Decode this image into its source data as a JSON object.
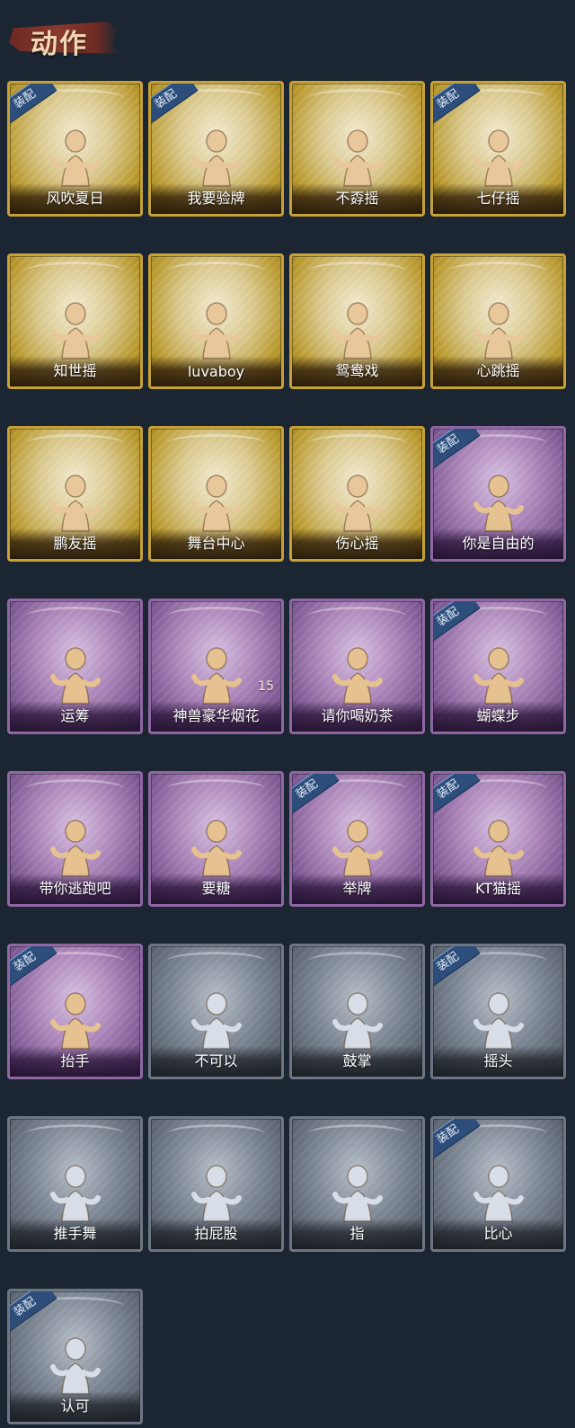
{
  "title": "动作",
  "badge_label": "装配",
  "cards": [
    {
      "label": "风吹夏日",
      "tier": "gold",
      "equipped": true,
      "count": ""
    },
    {
      "label": "我要验牌",
      "tier": "gold",
      "equipped": true,
      "count": ""
    },
    {
      "label": "不孬摇",
      "tier": "gold",
      "equipped": false,
      "count": ""
    },
    {
      "label": "七仔摇",
      "tier": "gold",
      "equipped": true,
      "count": ""
    },
    {
      "label": "知世摇",
      "tier": "gold",
      "equipped": false,
      "count": ""
    },
    {
      "label": "luvaboy",
      "tier": "gold",
      "equipped": false,
      "count": ""
    },
    {
      "label": "鸳鸯戏",
      "tier": "gold",
      "equipped": false,
      "count": ""
    },
    {
      "label": "心跳摇",
      "tier": "gold",
      "equipped": false,
      "count": ""
    },
    {
      "label": "鹏友摇",
      "tier": "gold",
      "equipped": false,
      "count": ""
    },
    {
      "label": "舞台中心",
      "tier": "gold",
      "equipped": false,
      "count": ""
    },
    {
      "label": "伤心摇",
      "tier": "gold",
      "equipped": false,
      "count": ""
    },
    {
      "label": "你是自由的",
      "tier": "purple",
      "equipped": true,
      "count": ""
    },
    {
      "label": "运筹",
      "tier": "purple",
      "equipped": false,
      "count": ""
    },
    {
      "label": "神兽豪华烟花",
      "tier": "purple",
      "equipped": false,
      "count": "15"
    },
    {
      "label": "请你喝奶茶",
      "tier": "purple",
      "equipped": false,
      "count": ""
    },
    {
      "label": "蝴蝶步",
      "tier": "purple",
      "equipped": true,
      "count": ""
    },
    {
      "label": "带你逃跑吧",
      "tier": "purple",
      "equipped": false,
      "count": ""
    },
    {
      "label": "要糖",
      "tier": "purple",
      "equipped": false,
      "count": ""
    },
    {
      "label": "举牌",
      "tier": "purple",
      "equipped": true,
      "count": ""
    },
    {
      "label": "KT猫摇",
      "tier": "purple",
      "equipped": true,
      "count": ""
    },
    {
      "label": "抬手",
      "tier": "purple",
      "equipped": true,
      "count": ""
    },
    {
      "label": "不可以",
      "tier": "gray",
      "equipped": false,
      "count": ""
    },
    {
      "label": "鼓掌",
      "tier": "gray",
      "equipped": false,
      "count": ""
    },
    {
      "label": "摇头",
      "tier": "gray",
      "equipped": true,
      "count": ""
    },
    {
      "label": "推手舞",
      "tier": "gray",
      "equipped": false,
      "count": ""
    },
    {
      "label": "拍屁股",
      "tier": "gray",
      "equipped": false,
      "count": ""
    },
    {
      "label": "指",
      "tier": "gray",
      "equipped": false,
      "count": ""
    },
    {
      "label": "比心",
      "tier": "gray",
      "equipped": true,
      "count": ""
    },
    {
      "label": "认可",
      "tier": "gray",
      "equipped": true,
      "count": ""
    }
  ]
}
